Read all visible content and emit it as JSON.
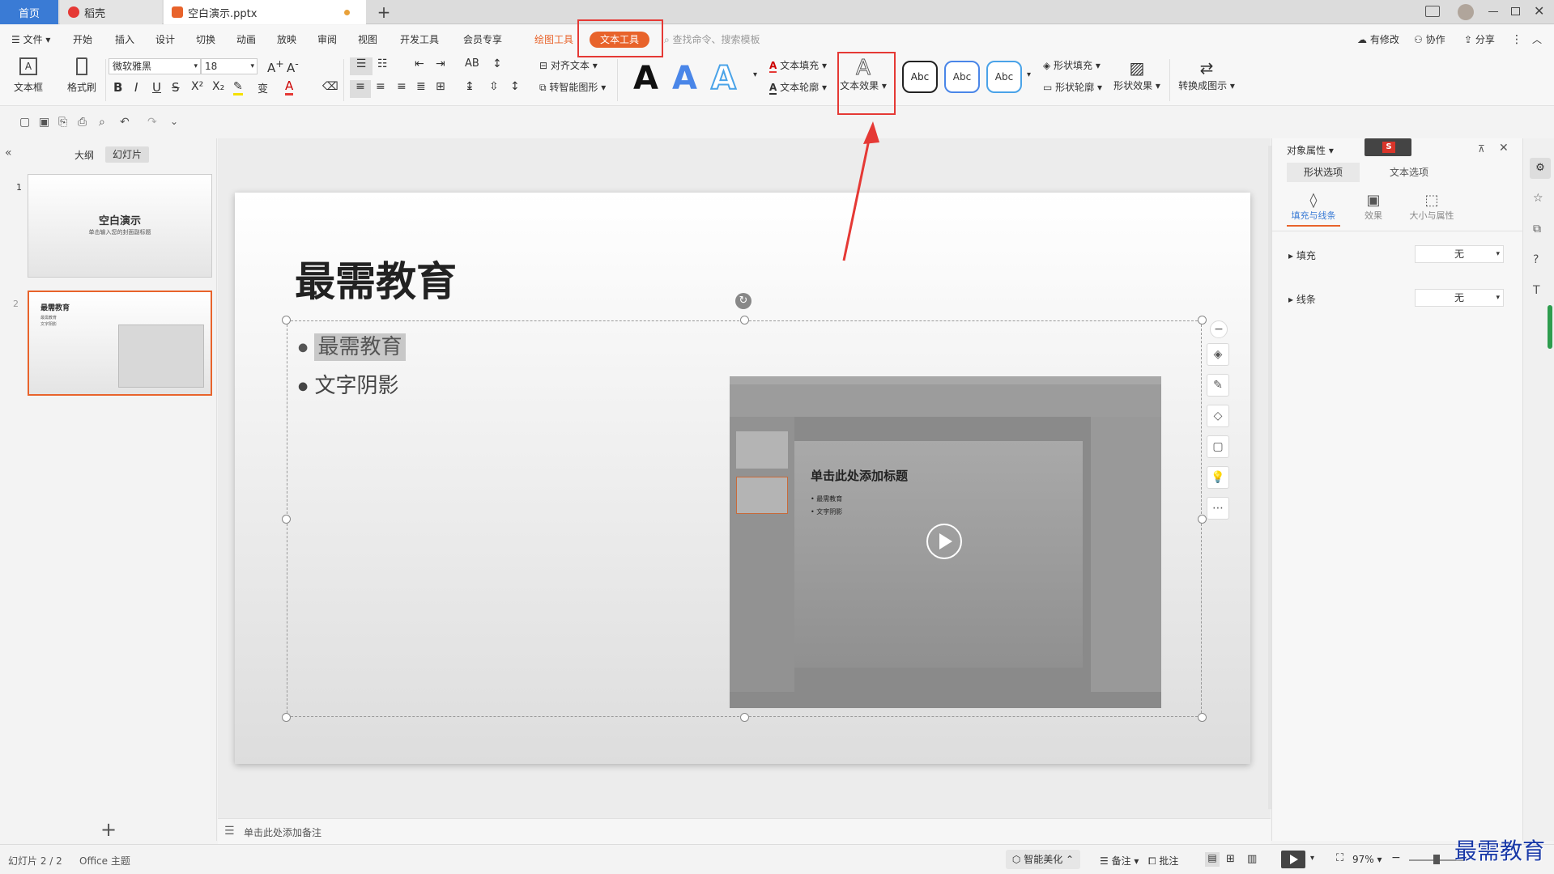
{
  "tabs": {
    "home": "首页",
    "wps": "稻壳",
    "file": "空白演示.pptx",
    "add": "+"
  },
  "menu": {
    "file": "文件",
    "items": [
      "开始",
      "插入",
      "设计",
      "切换",
      "动画",
      "放映",
      "审阅",
      "视图",
      "开发工具",
      "会员专享"
    ],
    "drawing_tools": "绘图工具",
    "text_tools": "文本工具",
    "search_placeholder": "查找命令、搜索模板",
    "has_changes": "有修改",
    "collaborate": "协作",
    "share": "分享"
  },
  "ribbon": {
    "textbox": "文本框",
    "format_painter": "格式刷",
    "font_name": "微软雅黑",
    "font_size": "18",
    "align_text": "对齐文本",
    "smart_shape": "转智能图形",
    "text_fill": "文本填充",
    "text_outline": "文本轮廓",
    "text_effect": "文本效果",
    "abc": "Abc",
    "shape_fill": "形状填充",
    "shape_outline": "形状轮廓",
    "shape_effect": "形状效果",
    "convert_to_diagram": "转换成图示",
    "letter_A": "A"
  },
  "left_panel": {
    "outline_tab": "大纲",
    "slides_tab": "幻灯片",
    "slide1_number": "1",
    "slide1_title": "空白演示",
    "slide1_subtitle": "单击输入您的封面副标题",
    "slide2_number": "2",
    "slide2_title": "最需教育",
    "slide2_bullets": [
      "最需教育",
      "文字阴影"
    ],
    "add_slide": "+"
  },
  "slide": {
    "title": "最需教育",
    "bullets": [
      "最需教育",
      "文字阴影"
    ],
    "video": {
      "inner_title": "单击此处添加标题",
      "inner_bullets": [
        "最需教育",
        "文字阴影"
      ]
    }
  },
  "notes": {
    "placeholder": "单击此处添加备注"
  },
  "right_panel": {
    "title": "对象属性",
    "tab_shape": "形状选项",
    "tab_text": "文本选项",
    "sub_fill_line": "填充与线条",
    "sub_effect": "效果",
    "sub_size": "大小与属性",
    "fill_label": "填充",
    "fill_value": "无",
    "line_label": "线条",
    "line_value": "无"
  },
  "status": {
    "slide_index": "幻灯片 2 / 2",
    "theme": "Office 主题",
    "smart_beautify": "智能美化",
    "notes": "备注",
    "comments": "批注",
    "zoom": "97%"
  },
  "watermark": "最需教育",
  "colors": {
    "accent_blue": "#3a7bd5",
    "accent_orange": "#e8632b",
    "highlight_red": "#e53935",
    "wps_red": "#d9352a"
  }
}
